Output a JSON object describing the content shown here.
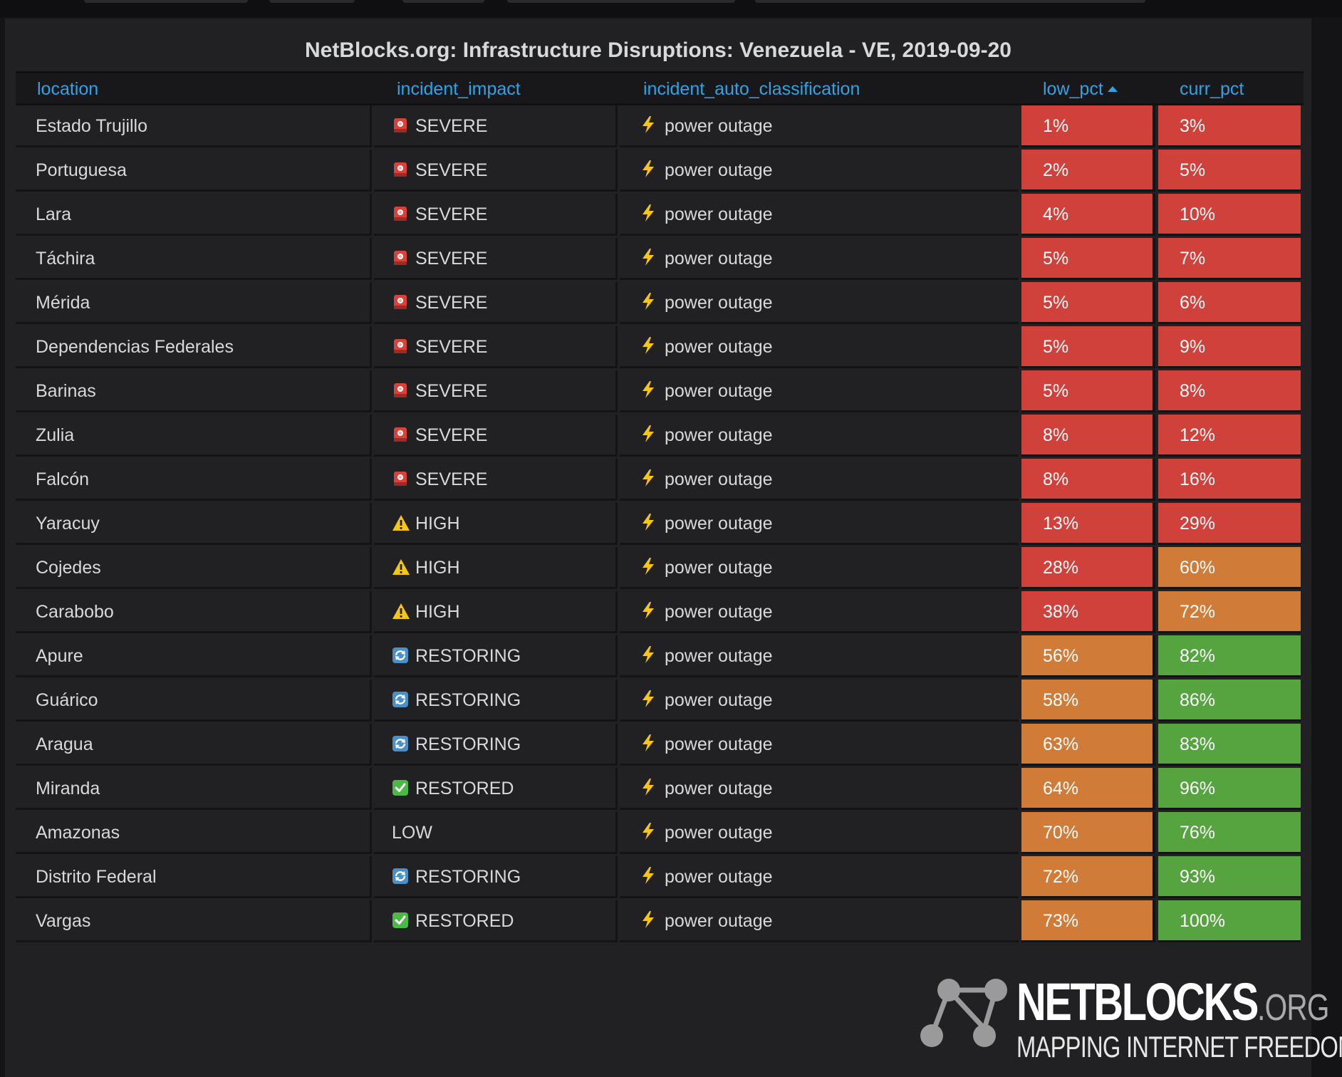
{
  "panel": {
    "title": "NetBlocks.org: Infrastructure Disruptions: Venezuela - VE, 2019-09-20"
  },
  "table": {
    "columns": [
      "location",
      "incident_impact",
      "incident_auto_classification",
      "low_pct",
      "curr_pct"
    ],
    "sorted_column": "low_pct",
    "sort_direction": "ascending",
    "rows": [
      {
        "location": "Estado Trujillo",
        "impact": "SEVERE",
        "impact_icon": "siren-icon",
        "classification": "power outage",
        "low_pct": "1%",
        "low_color": "red",
        "curr_pct": "3%",
        "curr_color": "red"
      },
      {
        "location": "Portuguesa",
        "impact": "SEVERE",
        "impact_icon": "siren-icon",
        "classification": "power outage",
        "low_pct": "2%",
        "low_color": "red",
        "curr_pct": "5%",
        "curr_color": "red"
      },
      {
        "location": "Lara",
        "impact": "SEVERE",
        "impact_icon": "siren-icon",
        "classification": "power outage",
        "low_pct": "4%",
        "low_color": "red",
        "curr_pct": "10%",
        "curr_color": "red"
      },
      {
        "location": "Táchira",
        "impact": "SEVERE",
        "impact_icon": "siren-icon",
        "classification": "power outage",
        "low_pct": "5%",
        "low_color": "red",
        "curr_pct": "7%",
        "curr_color": "red"
      },
      {
        "location": "Mérida",
        "impact": "SEVERE",
        "impact_icon": "siren-icon",
        "classification": "power outage",
        "low_pct": "5%",
        "low_color": "red",
        "curr_pct": "6%",
        "curr_color": "red"
      },
      {
        "location": "Dependencias Federales",
        "impact": "SEVERE",
        "impact_icon": "siren-icon",
        "classification": "power outage",
        "low_pct": "5%",
        "low_color": "red",
        "curr_pct": "9%",
        "curr_color": "red"
      },
      {
        "location": "Barinas",
        "impact": "SEVERE",
        "impact_icon": "siren-icon",
        "classification": "power outage",
        "low_pct": "5%",
        "low_color": "red",
        "curr_pct": "8%",
        "curr_color": "red"
      },
      {
        "location": "Zulia",
        "impact": "SEVERE",
        "impact_icon": "siren-icon",
        "classification": "power outage",
        "low_pct": "8%",
        "low_color": "red",
        "curr_pct": "12%",
        "curr_color": "red"
      },
      {
        "location": "Falcón",
        "impact": "SEVERE",
        "impact_icon": "siren-icon",
        "classification": "power outage",
        "low_pct": "8%",
        "low_color": "red",
        "curr_pct": "16%",
        "curr_color": "red"
      },
      {
        "location": "Yaracuy",
        "impact": "HIGH",
        "impact_icon": "warning-icon",
        "classification": "power outage",
        "low_pct": "13%",
        "low_color": "red",
        "curr_pct": "29%",
        "curr_color": "red"
      },
      {
        "location": "Cojedes",
        "impact": "HIGH",
        "impact_icon": "warning-icon",
        "classification": "power outage",
        "low_pct": "28%",
        "low_color": "red",
        "curr_pct": "60%",
        "curr_color": "orange"
      },
      {
        "location": "Carabobo",
        "impact": "HIGH",
        "impact_icon": "warning-icon",
        "classification": "power outage",
        "low_pct": "38%",
        "low_color": "red",
        "curr_pct": "72%",
        "curr_color": "orange"
      },
      {
        "location": "Apure",
        "impact": "RESTORING",
        "impact_icon": "refresh-icon",
        "classification": "power outage",
        "low_pct": "56%",
        "low_color": "orange",
        "curr_pct": "82%",
        "curr_color": "green"
      },
      {
        "location": "Guárico",
        "impact": "RESTORING",
        "impact_icon": "refresh-icon",
        "classification": "power outage",
        "low_pct": "58%",
        "low_color": "orange",
        "curr_pct": "86%",
        "curr_color": "green"
      },
      {
        "location": "Aragua",
        "impact": "RESTORING",
        "impact_icon": "refresh-icon",
        "classification": "power outage",
        "low_pct": "63%",
        "low_color": "orange",
        "curr_pct": "83%",
        "curr_color": "green"
      },
      {
        "location": "Miranda",
        "impact": "RESTORED",
        "impact_icon": "check-icon",
        "classification": "power outage",
        "low_pct": "64%",
        "low_color": "orange",
        "curr_pct": "96%",
        "curr_color": "green"
      },
      {
        "location": "Amazonas",
        "impact": "LOW",
        "impact_icon": "",
        "classification": "power outage",
        "low_pct": "70%",
        "low_color": "orange",
        "curr_pct": "76%",
        "curr_color": "green"
      },
      {
        "location": "Distrito Federal",
        "impact": "RESTORING",
        "impact_icon": "refresh-icon",
        "classification": "power outage",
        "low_pct": "72%",
        "low_color": "orange",
        "curr_pct": "93%",
        "curr_color": "green"
      },
      {
        "location": "Vargas",
        "impact": "RESTORED",
        "impact_icon": "check-icon",
        "classification": "power outage",
        "low_pct": "73%",
        "low_color": "orange",
        "curr_pct": "100%",
        "curr_color": "green"
      }
    ]
  },
  "colors": {
    "red": "#d0413b",
    "orange": "#d07c38",
    "green": "#56a440",
    "header_link": "#33a2e5",
    "panel_bg": "#212124"
  },
  "logo": {
    "word": "NETBLOCKS",
    "suffix": ".ORG",
    "tagline": "MAPPING INTERNET FREEDOM"
  }
}
